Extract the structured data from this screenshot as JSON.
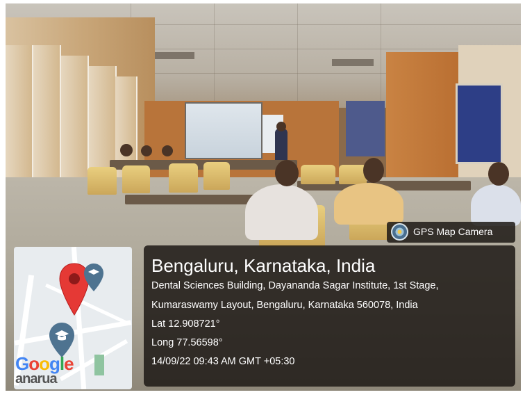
{
  "app": {
    "name": "GPS Map Camera"
  },
  "location": {
    "title": "Bengaluru, Karnataka, India",
    "address_line1": "Dental Sciences Building, Dayananda Sagar Institute, 1st Stage,",
    "address_line2": "Kumaraswamy Layout, Bengaluru, Karnataka 560078, India",
    "lat": "Lat 12.908721°",
    "long": "Long 77.56598°",
    "timestamp": "14/09/22 09:43 AM GMT +05:30"
  },
  "minimap": {
    "brand": "Google",
    "sub_label": "anarua",
    "pin_icon": "map-pin-icon",
    "graduation_icon": "graduation-cap-icon"
  },
  "colors": {
    "overlay_bg": "#1e1a16",
    "pin_red": "#e53935",
    "badge_blue": "#4a6f8f"
  }
}
